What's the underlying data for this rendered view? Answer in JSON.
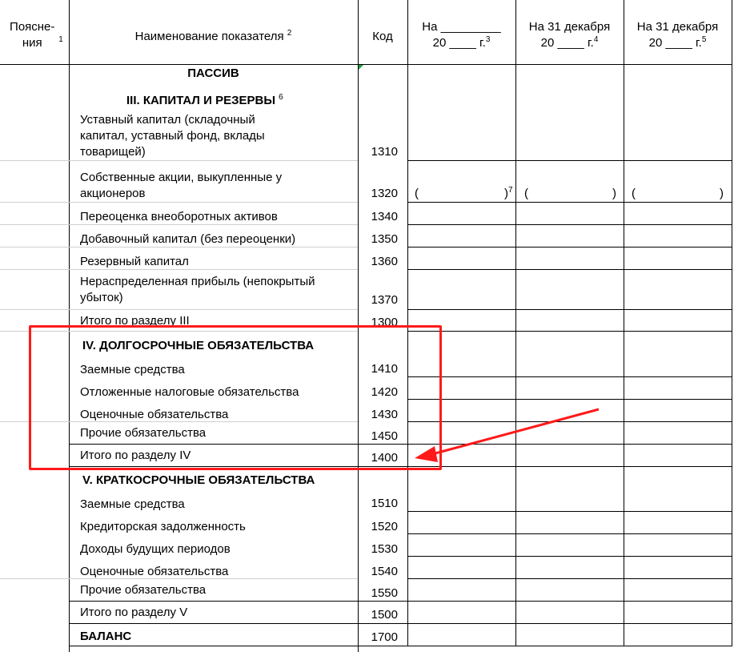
{
  "header": {
    "col_notes": "Поясне-ния",
    "col_notes_sup": "1",
    "col_name": "Наименование показателя",
    "col_name_sup": "2",
    "col_code": "Код",
    "col_p1_line1": "На _________",
    "col_p1_line2": "20 ____  г.",
    "col_p1_sup": "3",
    "col_p2_line1": "На 31 декабря",
    "col_p2_line2": "20 ____  г.",
    "col_p2_sup": "4",
    "col_p3_line1": "На 31 декабря",
    "col_p3_line2": "20 ____  г.",
    "col_p3_sup": "5"
  },
  "sections": {
    "passive": "ПАССИВ",
    "s3_title": "III. КАПИТАЛ И РЕЗЕРВЫ",
    "s3_sup": "6",
    "s4_title": "IV. ДОЛГОСРОЧНЫЕ ОБЯЗАТЕЛЬСТВА",
    "s5_title": "V. КРАТКОСРОЧНЫЕ ОБЯЗАТЕЛЬСТВА"
  },
  "rows": [
    {
      "name_lines": [
        "Уставный капитал (складочный",
        "капитал, уставный фонд, вклады",
        "товарищей)"
      ],
      "code": "1310"
    },
    {
      "name_lines": [
        "Собственные акции, выкупленные у",
        "акционеров"
      ],
      "code": "1320"
    },
    {
      "name_lines": [
        "Переоценка внеоборотных активов"
      ],
      "code": "1340"
    },
    {
      "name_lines": [
        "Добавочный капитал (без переоценки)"
      ],
      "code": "1350"
    },
    {
      "name_lines": [
        "Резервный капитал"
      ],
      "code": "1360"
    },
    {
      "name_lines": [
        "Нераспределенная прибыль (непокрытый",
        "убыток)"
      ],
      "code": "1370"
    },
    {
      "name_lines": [
        "Итого по разделу III"
      ],
      "code": "1300"
    },
    {
      "name_lines": [
        "Заемные средства"
      ],
      "code": "1410"
    },
    {
      "name_lines": [
        "Отложенные налоговые обязательства"
      ],
      "code": "1420"
    },
    {
      "name_lines": [
        "Оценочные обязательства"
      ],
      "code": "1430"
    },
    {
      "name_lines": [
        "Прочие обязательства"
      ],
      "code": "1450"
    },
    {
      "name_lines": [
        "Итого по разделу IV"
      ],
      "code": "1400"
    },
    {
      "name_lines": [
        "Заемные средства"
      ],
      "code": "1510"
    },
    {
      "name_lines": [
        "Кредиторская задолженность"
      ],
      "code": "1520"
    },
    {
      "name_lines": [
        "Доходы будущих периодов"
      ],
      "code": "1530"
    },
    {
      "name_lines": [
        "Оценочные обязательства"
      ],
      "code": "1540"
    },
    {
      "name_lines": [
        "Прочие обязательства"
      ],
      "code": "1550"
    },
    {
      "name_lines": [
        "Итого по разделу V"
      ],
      "code": "1500"
    },
    {
      "name_lines": [
        "БАЛАНС"
      ],
      "code": "1700"
    }
  ],
  "parens": {
    "open": "(",
    "close": ")",
    "sup7": "7"
  },
  "annotation": {
    "highlight_color": "#ff1a1a"
  }
}
